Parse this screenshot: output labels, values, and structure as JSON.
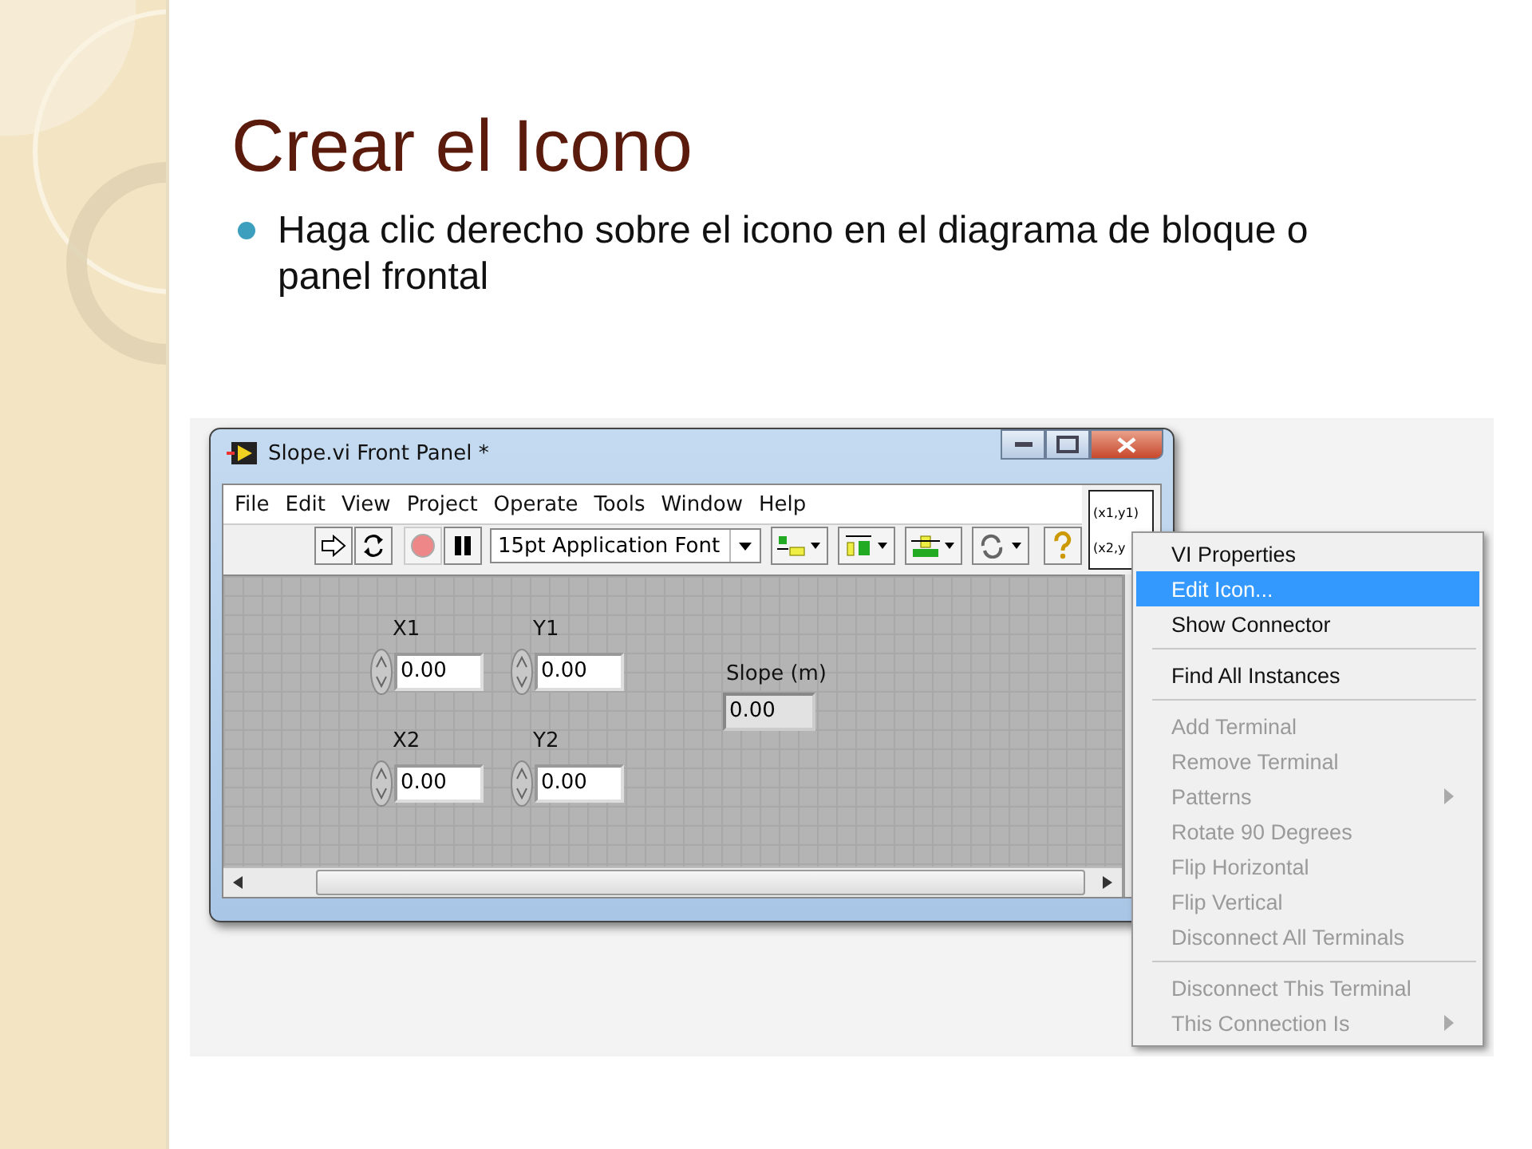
{
  "slide": {
    "title": "Crear el Icono",
    "bullets": [
      "Haga clic derecho sobre el icono en el diagrama de bloque o panel frontal"
    ]
  },
  "window": {
    "title": "Slope.vi Front Panel *",
    "menu": [
      "File",
      "Edit",
      "View",
      "Project",
      "Operate",
      "Tools",
      "Window",
      "Help"
    ],
    "toolbar": {
      "font": "15pt Application Font"
    },
    "vi_icon": {
      "lines": [
        "(x1,y1)",
        "(x2,y"
      ]
    },
    "controls": [
      {
        "label": "X1",
        "value": "0.00",
        "kind": "control"
      },
      {
        "label": "Y1",
        "value": "0.00",
        "kind": "control"
      },
      {
        "label": "Slope (m)",
        "value": "0.00",
        "kind": "indicator"
      },
      {
        "label": "X2",
        "value": "0.00",
        "kind": "control"
      },
      {
        "label": "Y2",
        "value": "0.00",
        "kind": "control"
      }
    ]
  },
  "context_menu": [
    {
      "kind": "item",
      "label": "VI Properties",
      "disabled": false,
      "selected": false,
      "submenu": false
    },
    {
      "kind": "item",
      "label": "Edit Icon...",
      "disabled": false,
      "selected": true,
      "submenu": false
    },
    {
      "kind": "item",
      "label": "Show Connector",
      "disabled": false,
      "selected": false,
      "submenu": false
    },
    {
      "kind": "separator"
    },
    {
      "kind": "item",
      "label": "Find All Instances",
      "disabled": false,
      "selected": false,
      "submenu": false
    },
    {
      "kind": "separator"
    },
    {
      "kind": "item",
      "label": "Add Terminal",
      "disabled": true,
      "selected": false,
      "submenu": false
    },
    {
      "kind": "item",
      "label": "Remove Terminal",
      "disabled": true,
      "selected": false,
      "submenu": false
    },
    {
      "kind": "item",
      "label": "Patterns",
      "disabled": true,
      "selected": false,
      "submenu": true
    },
    {
      "kind": "item",
      "label": "Rotate 90 Degrees",
      "disabled": true,
      "selected": false,
      "submenu": false
    },
    {
      "kind": "item",
      "label": "Flip Horizontal",
      "disabled": true,
      "selected": false,
      "submenu": false
    },
    {
      "kind": "item",
      "label": "Flip Vertical",
      "disabled": true,
      "selected": false,
      "submenu": false
    },
    {
      "kind": "item",
      "label": "Disconnect All Terminals",
      "disabled": true,
      "selected": false,
      "submenu": false
    },
    {
      "kind": "separator"
    },
    {
      "kind": "item",
      "label": "Disconnect This Terminal",
      "disabled": true,
      "selected": false,
      "submenu": false
    },
    {
      "kind": "item",
      "label": "This Connection Is",
      "disabled": true,
      "selected": false,
      "submenu": true
    }
  ]
}
